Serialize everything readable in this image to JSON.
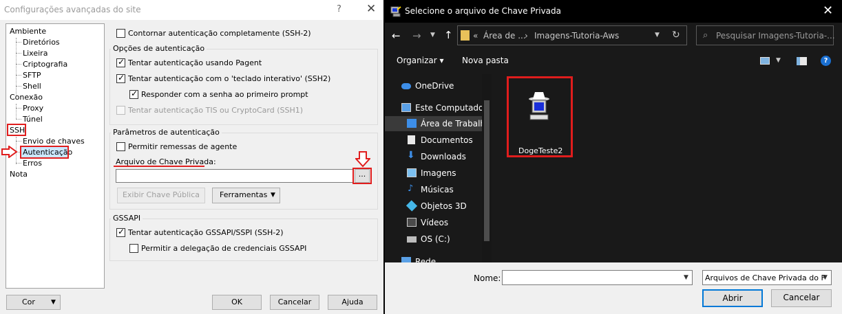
{
  "left": {
    "title": "Configurações avançadas do site",
    "help_icon": "?",
    "close_icon": "✕",
    "tree": [
      {
        "label": "Ambiente"
      },
      {
        "label": "Diretórios"
      },
      {
        "label": "Lixeira"
      },
      {
        "label": "Criptografia"
      },
      {
        "label": "SFTP"
      },
      {
        "label": "Shell"
      },
      {
        "label": "Conexão"
      },
      {
        "label": "Proxy"
      },
      {
        "label": "Túnel"
      },
      {
        "label": "SSH"
      },
      {
        "label": "Envio de chaves"
      },
      {
        "label": "Autenticação"
      },
      {
        "label": "Erros"
      },
      {
        "label": "Nota"
      }
    ],
    "bypass_label": "Contornar autenticação completamente (SSH-2)",
    "auth_options": {
      "title": "Opções de autenticação",
      "pageant": "Tentar autenticação usando Pagent",
      "keyboard": "Tentar autenticação com o 'teclado interativo' (SSH2)",
      "first_prompt": "Responder com a senha ao primeiro prompt",
      "tis": "Tentar autenticação TIS ou CryptoCard (SSH1)"
    },
    "auth_params": {
      "title": "Parâmetros de autenticação",
      "agent_forward": "Permitir remessas de agente",
      "key_file_label": "Arquivo de Chave Privada:",
      "key_file_value": "",
      "browse": "...",
      "show_public_key": "Exibir Chave Pública",
      "tools": "Ferramentas"
    },
    "gssapi": {
      "title": "GSSAPI",
      "try": "Tentar autenticação GSSAPI/SSPI (SSH-2)",
      "delegate": "Permitir a delegação de credenciais GSSAPI"
    },
    "buttons": {
      "color": "Cor",
      "ok": "OK",
      "cancel": "Cancelar",
      "help": "Ajuda"
    }
  },
  "right": {
    "title": "Selecione o arquivo de Chave Privada",
    "close_icon": "✕",
    "address": {
      "prefix": "«",
      "crumb1": "Área de ...",
      "sep": "›",
      "crumb2": "Imagens-Tutoria-Aws"
    },
    "search_placeholder": "Pesquisar Imagens-Tutoria-...",
    "toolbar": {
      "organize": "Organizar ▾",
      "new_folder": "Nova pasta"
    },
    "nav": [
      {
        "label": "OneDrive",
        "icon": "cloud-icon"
      },
      {
        "label": "Este Computador",
        "icon": "computer-icon"
      },
      {
        "label": "Área de Trabalho",
        "icon": "desktop-icon"
      },
      {
        "label": "Documentos",
        "icon": "document-icon"
      },
      {
        "label": "Downloads",
        "icon": "download-icon"
      },
      {
        "label": "Imagens",
        "icon": "image-icon"
      },
      {
        "label": "Músicas",
        "icon": "music-icon"
      },
      {
        "label": "Objetos 3D",
        "icon": "cube-icon"
      },
      {
        "label": "Vídeos",
        "icon": "video-icon"
      },
      {
        "label": "OS (C:)",
        "icon": "drive-icon"
      },
      {
        "label": "Rede",
        "icon": "network-icon"
      }
    ],
    "file": {
      "name": "DogeTeste2"
    },
    "bottom": {
      "name_label": "Nome:",
      "name_value": "",
      "filter": "Arquivos de Chave Privada do F",
      "open": "Abrir",
      "cancel": "Cancelar"
    }
  },
  "colors": {
    "highlight": "#e01d1d",
    "dark_bg": "#191919",
    "dialog_bg": "#f0f0f0"
  }
}
